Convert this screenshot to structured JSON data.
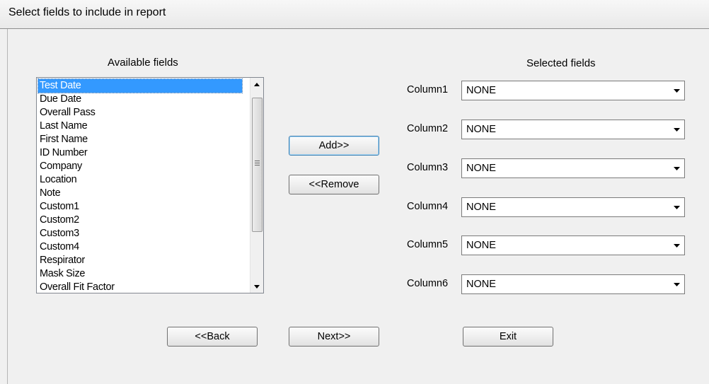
{
  "window": {
    "title": "Select fields to include in report"
  },
  "available": {
    "heading": "Available fields",
    "items": [
      "Test Date",
      "Due Date",
      "Overall Pass",
      "Last Name",
      "First Name",
      "ID Number",
      "Company",
      "Location",
      "Note",
      "Custom1",
      "Custom2",
      "Custom3",
      "Custom4",
      "Respirator",
      "Mask Size",
      "Overall Fit Factor"
    ],
    "selected_index": 0
  },
  "selected": {
    "heading": "Selected fields",
    "columns": [
      {
        "label": "Column1",
        "value": "NONE"
      },
      {
        "label": "Column2",
        "value": "NONE"
      },
      {
        "label": "Column3",
        "value": "NONE"
      },
      {
        "label": "Column4",
        "value": "NONE"
      },
      {
        "label": "Column5",
        "value": "NONE"
      },
      {
        "label": "Column6",
        "value": "NONE"
      }
    ]
  },
  "buttons": {
    "add": "Add>>",
    "remove": "<<Remove",
    "back": "<<Back",
    "next": "Next>>",
    "exit": "Exit"
  },
  "icons": {
    "scroll_up": "scroll-up-arrow-icon",
    "scroll_down": "scroll-down-arrow-icon",
    "dropdown": "chevron-down-icon"
  },
  "colors": {
    "selection": "#3399ff",
    "window_bg": "#f0f0f0"
  }
}
